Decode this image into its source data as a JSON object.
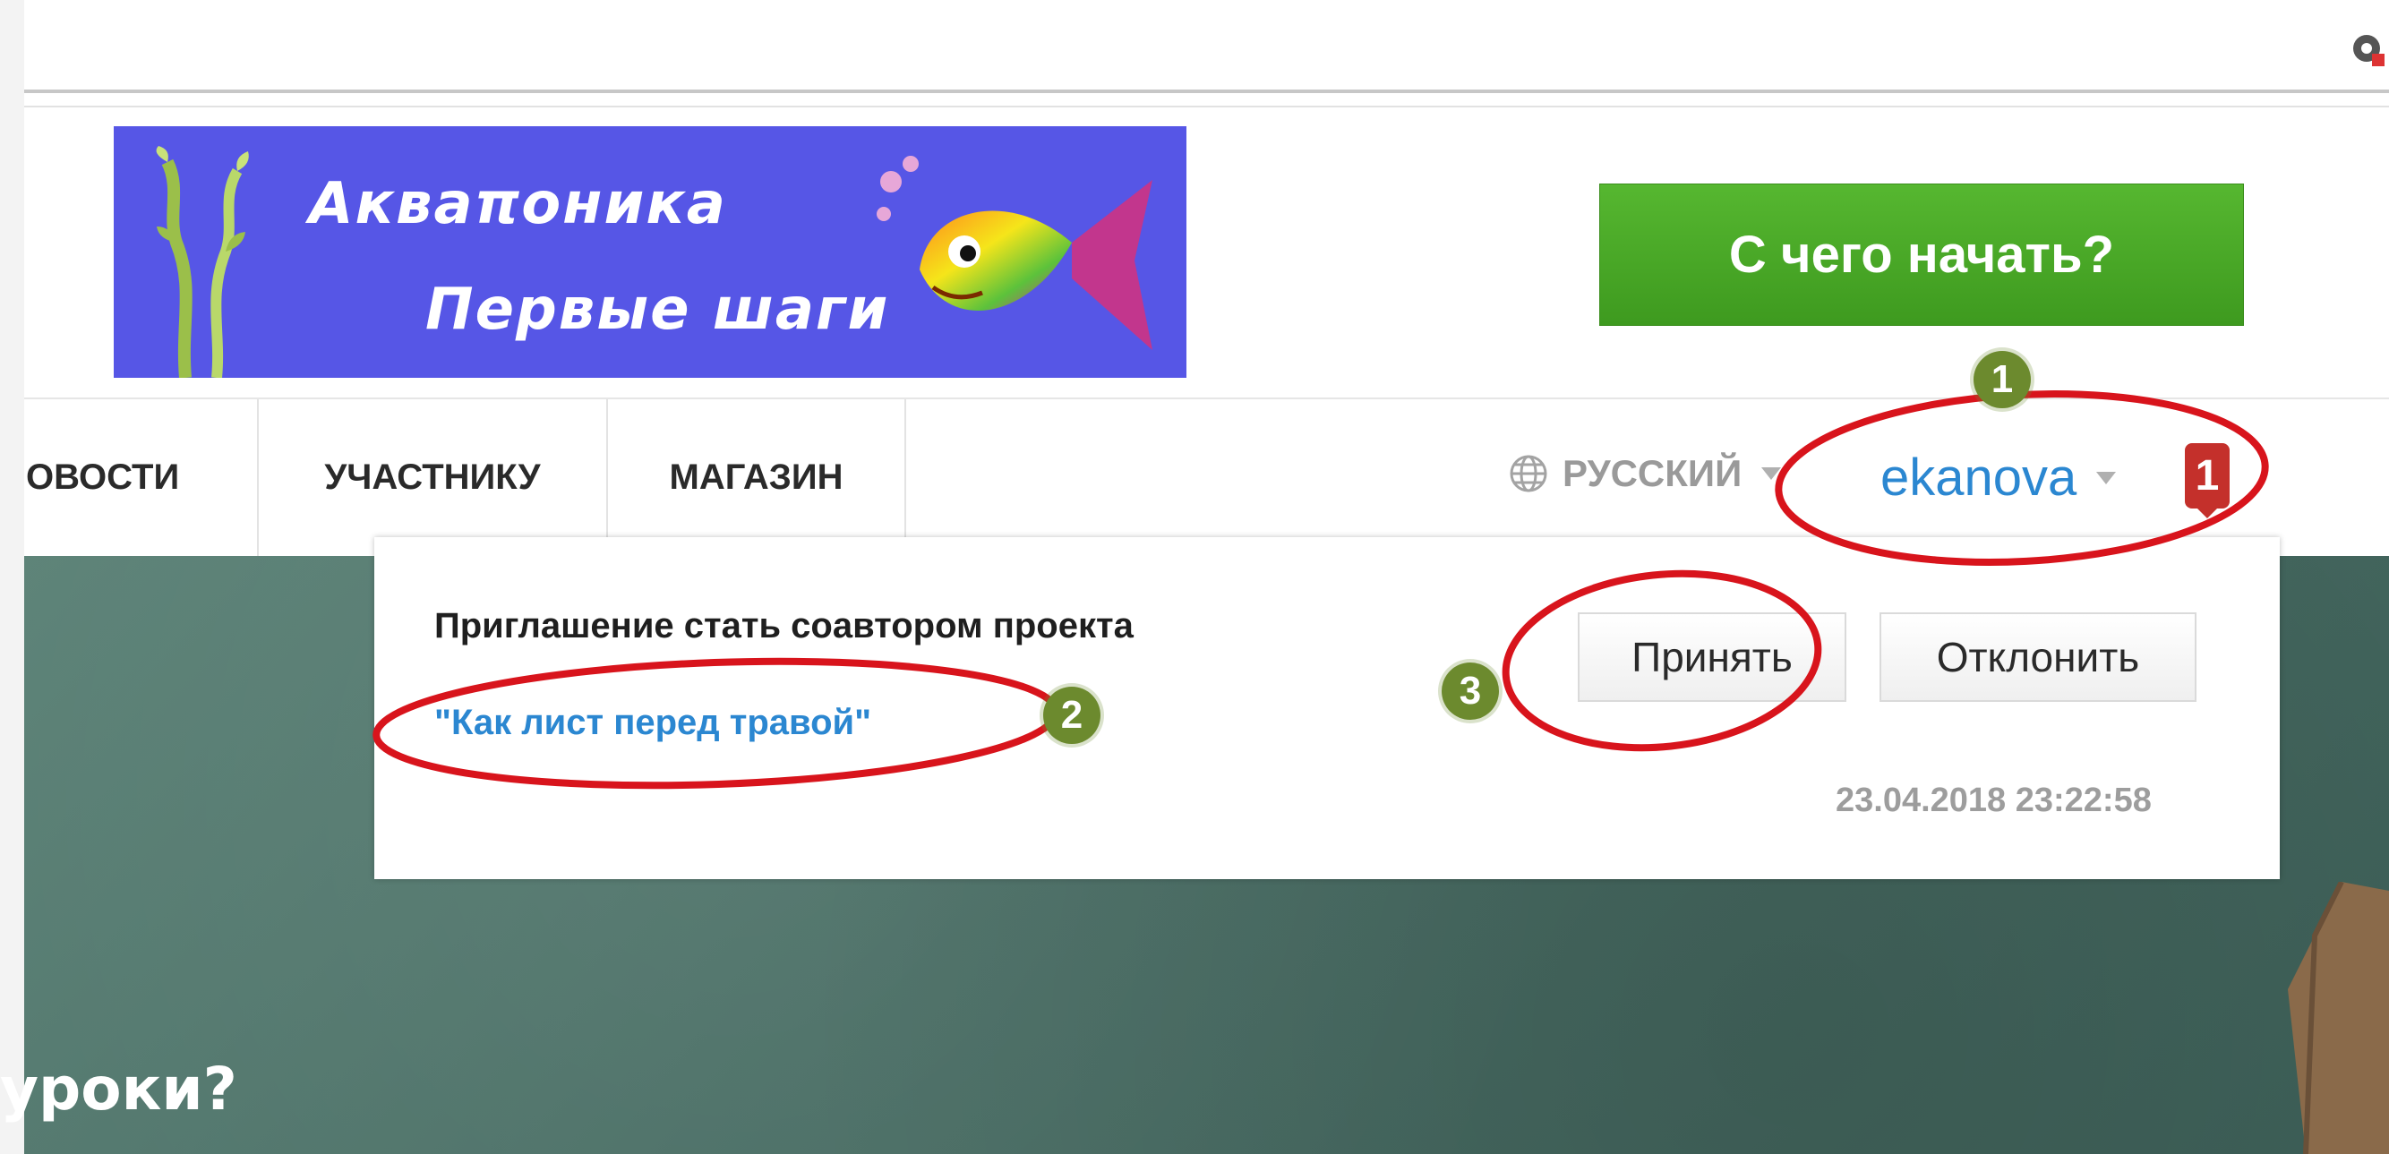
{
  "banner": {
    "line1": "Акваποника",
    "line2": "Первые шаги"
  },
  "header": {
    "start_button": "С чего начать?"
  },
  "nav": {
    "items": [
      {
        "label": "ОВОСТИ"
      },
      {
        "label": "УЧАСТНИКУ"
      },
      {
        "label": "МАГАЗИН"
      }
    ],
    "language": "РУССКИЙ",
    "username": "ekanova",
    "notification_count": "1"
  },
  "notification": {
    "title": "Приглашение стать соавтором проекта",
    "project_link": "\"Как лист перед травой\"",
    "accept_label": "Принять",
    "decline_label": "Отклонить",
    "timestamp": "23.04.2018 23:22:58"
  },
  "hero": {
    "text": "уроки?"
  },
  "annotations": {
    "markers": [
      "1",
      "2",
      "3"
    ]
  },
  "colors": {
    "accent_link": "#2b87d1",
    "start_button": "#4aa826",
    "notification_badge": "#c4302b",
    "annotation_circle": "#d8141c",
    "annotation_marker": "#6c8a2e",
    "banner_bg": "#5656e6"
  },
  "icons": {
    "language": "globe-icon",
    "extension": "extension-icon"
  }
}
